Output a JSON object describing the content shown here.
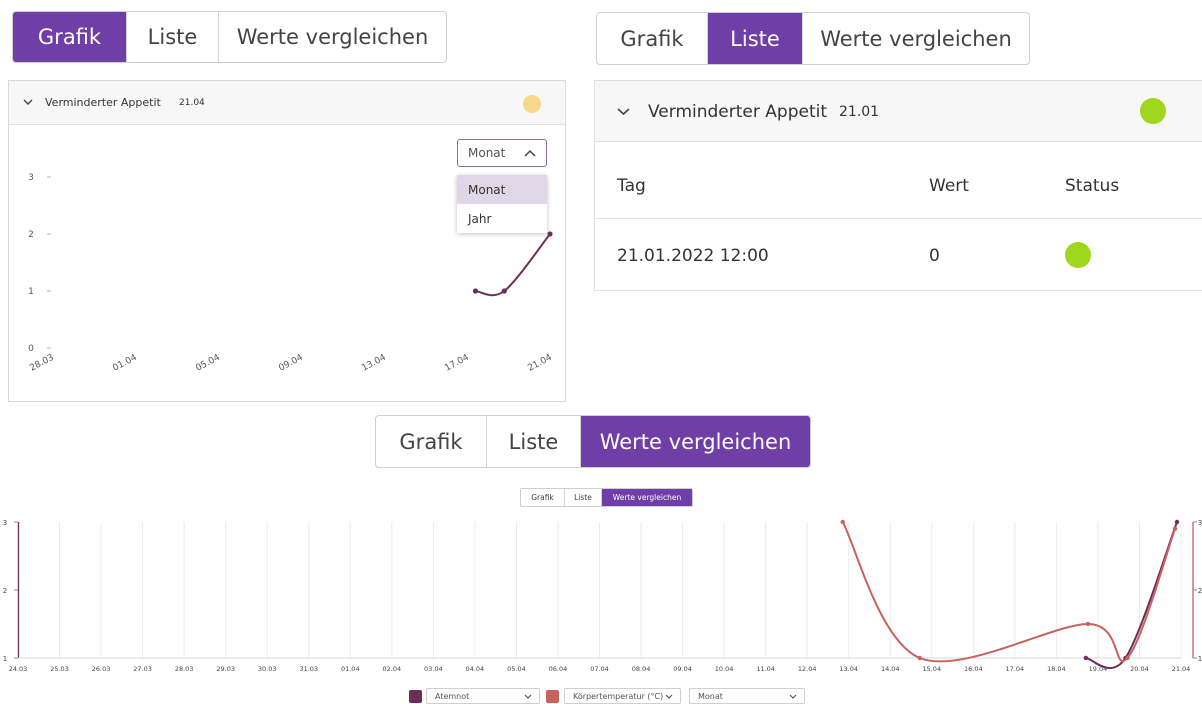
{
  "tabs_top_left": {
    "grafik": "Grafik",
    "liste": "Liste",
    "vergleichen": "Werte vergleichen"
  },
  "tabs_top_right": {
    "grafik": "Grafik",
    "liste": "Liste",
    "vergleichen": "Werte vergleichen"
  },
  "tabs_middle": {
    "grafik": "Grafik",
    "liste": "Liste",
    "vergleichen": "Werte vergleichen"
  },
  "tabs_small": {
    "grafik": "Grafik",
    "liste": "Liste",
    "vergleichen": "Werte vergleichen"
  },
  "accent_color": "#6f3ea6",
  "graph_panel": {
    "symptom": "Verminderter Appetit",
    "date": "21.04",
    "status_color": "#f8d98a",
    "period_select": "Monat",
    "period_options": [
      "Monat",
      "Jahr"
    ]
  },
  "list_panel": {
    "symptom": "Verminderter Appetit",
    "date": "21.01",
    "status_color": "#9fd61e",
    "columns": {
      "tag": "Tag",
      "wert": "Wert",
      "status": "Status"
    },
    "rows": [
      {
        "tag": "21.01.2022 12:00",
        "wert": "0",
        "status_color": "#9fd61e"
      }
    ]
  },
  "compare_legend": {
    "series1": "Atemnot",
    "series2": "Körpertemperatur (°C)",
    "period": "Monat",
    "series1_color": "#6b2e5a",
    "series2_color": "#c8625f"
  },
  "chart_data": [
    {
      "type": "line",
      "x_ticks": [
        "28.03",
        "01.04",
        "05.04",
        "09.04",
        "13.04",
        "17.04",
        "21.04"
      ],
      "y_ticks": [
        "0",
        "1",
        "2",
        "3"
      ],
      "ylim": [
        0,
        3
      ],
      "series": [
        {
          "x": [
            "19.04",
            "20.04",
            "21.04"
          ],
          "values": [
            1,
            1,
            2
          ]
        }
      ]
    },
    {
      "type": "line",
      "x_ticks": [
        "24.03",
        "25.03",
        "26.03",
        "27.03",
        "28.03",
        "29.03",
        "30.03",
        "31.03",
        "01.04",
        "02.04",
        "03.04",
        "04.04",
        "05.04",
        "06.04",
        "07.04",
        "08.04",
        "09.04",
        "10.04",
        "11.04",
        "12.04",
        "13.04",
        "14.04",
        "15.04",
        "16.04",
        "17.04",
        "18.04",
        "19.04",
        "20.04",
        "21.04"
      ],
      "y_ticks": [
        "1",
        "2",
        "3"
      ],
      "ylim": [
        1,
        3
      ],
      "series": [
        {
          "name": "Atemnot",
          "x": [
            "19.04",
            "20.04",
            "21.04"
          ],
          "values": [
            1,
            1,
            3
          ]
        },
        {
          "name": "Körpertemperatur (°C)",
          "x": [
            "13.04",
            "15.04",
            "19.04",
            "20.04",
            "21.04"
          ],
          "values": [
            3,
            1,
            1.5,
            1,
            2.9
          ]
        }
      ]
    }
  ]
}
